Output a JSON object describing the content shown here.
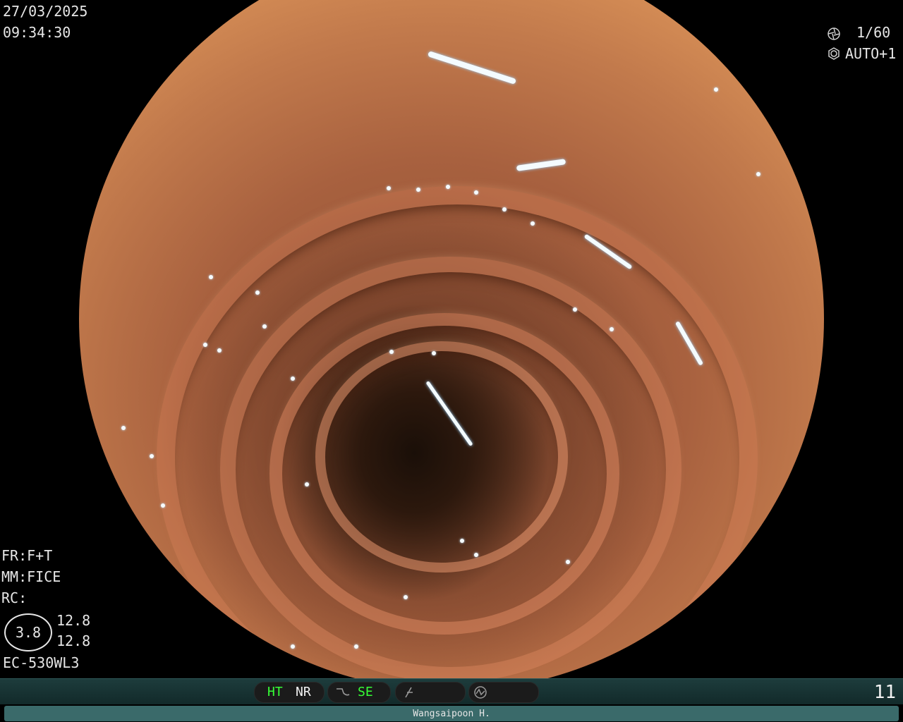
{
  "header": {
    "date": "27/03/2025",
    "time": "09:34:30",
    "shutter": "1/60",
    "exposure": "AUTO+1",
    "shutter_icon": "aperture-icon",
    "exposure_icon": "iris-icon"
  },
  "side_info": {
    "fr": "FR:F+T",
    "mm": "MM:FICE",
    "rc": "RC:",
    "ratio": "3.8",
    "value_top": "12.8",
    "value_bottom": "12.8",
    "scope_model": "EC-530WL3"
  },
  "status_bar": {
    "ht_label": "HT",
    "nr_label": "NR",
    "se_label": "SE",
    "se_icon": "wave-icon",
    "function_icon": "slash-f-icon",
    "mode_icon": "waveform-circle-icon",
    "frame_count": "11",
    "colors": {
      "active": "#36ff36",
      "inactive": "#f2f2f2",
      "bar": "#1d3c3c"
    }
  },
  "footer": {
    "operator": "Wangsaipoon H."
  }
}
